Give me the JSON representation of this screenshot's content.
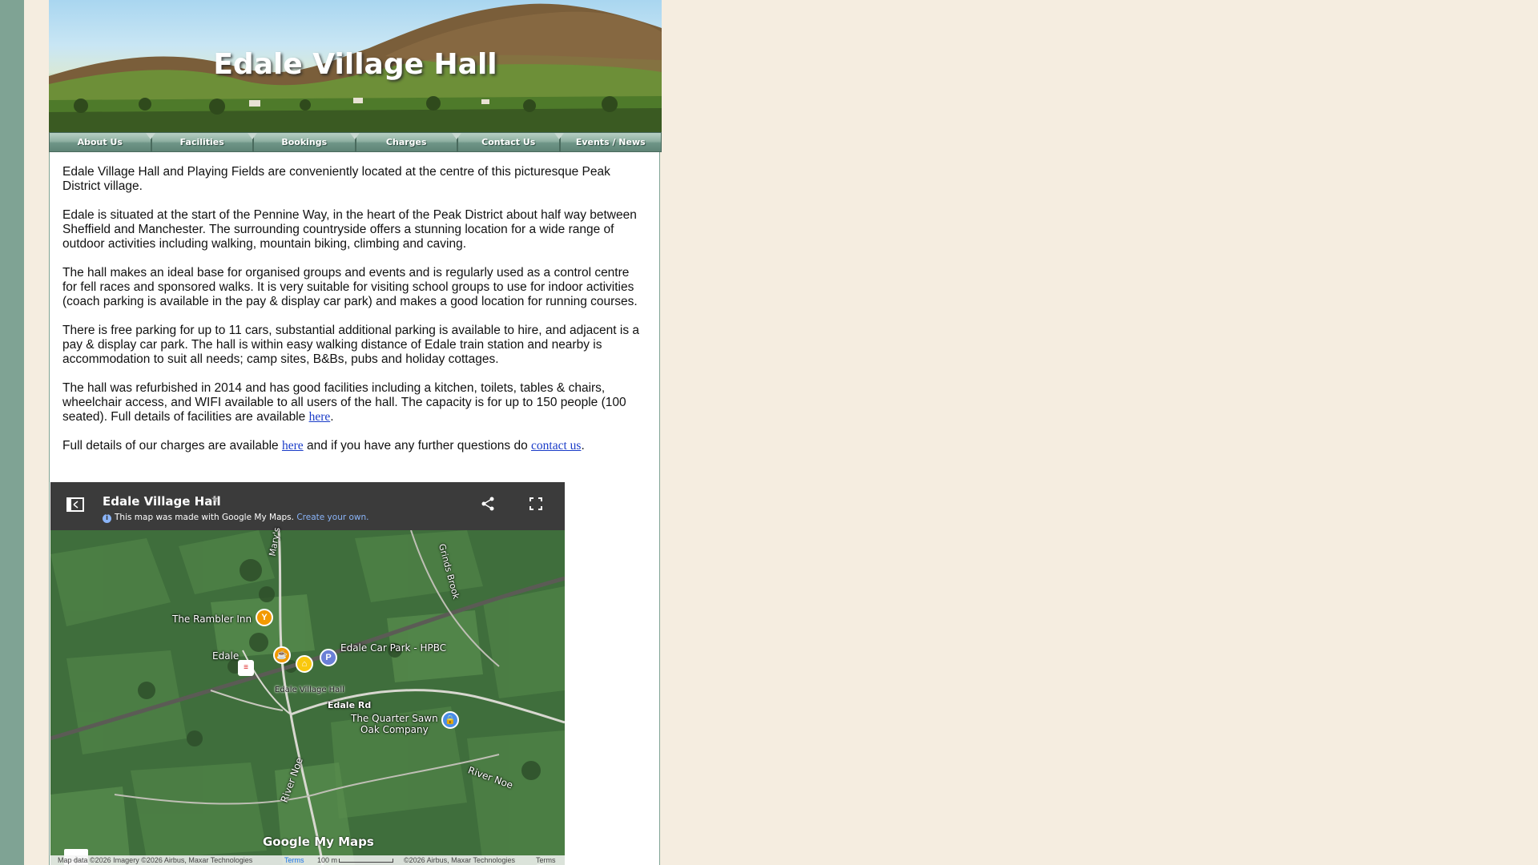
{
  "site": {
    "title": "Edale Village Hall"
  },
  "nav": {
    "items": [
      "About Us",
      "Facilities",
      "Bookings",
      "Charges",
      "Contact Us",
      "Events / News"
    ]
  },
  "content": {
    "p1": "Edale Village Hall and Playing Fields are conveniently located at the centre of this picturesque Peak District village.",
    "p2": "Edale is situated at the start of the Pennine Way, in the heart of the Peak District about half way between Sheffield and Manchester. The surrounding countryside offers a stunning location for a wide range of outdoor activities including walking, mountain biking, climbing and caving.",
    "p3": "The hall makes an ideal base for organised groups and events and is regularly used as a control centre for fell races and sponsored walks. It is very suitable for visiting school groups to use for indoor activities (coach parking is available in the pay & display car park) and makes a good location for running courses.",
    "p4": "There is free parking for up to 11 cars, substantial additional parking is available to hire, and adjacent is a pay & display car park. The hall is within easy walking distance of Edale train station and nearby is accommodation to suit all needs; camp sites, B&Bs, pubs and holiday cottages.",
    "p5_text": "The hall was refurbished in 2014 and has good facilities including a kitchen, toilets, tables & chairs, wheelchair access, and WIFI available to all users of the hall. The capacity is for up to 150 people (100 seated). Full details of facilities are available ",
    "p5_link": "here",
    "p5_end": ".",
    "p6_text": "Full details of our charges are available ",
    "p6_link1": "here",
    "p6_mid": " and if you have any further questions do ",
    "p6_link2": "contact us",
    "p6_end": "."
  },
  "map": {
    "title": "Edale Village Hall",
    "subtitle": "This map was made with Google My Maps.",
    "create_link": "Create your own.",
    "labels": {
      "rambler": "The Rambler Inn",
      "edale": "Edale",
      "car_park": "Edale Car Park - HPBC",
      "village_hall": "Edale Village Hall",
      "edale_rd": "Edale Rd",
      "quarter_sawn": "The Quarter Sawn\nOak Company",
      "river_noe_1": "River Noe",
      "river_noe_2": "River Noe",
      "grinds_brook": "Grinds Brook",
      "marys": "Mary's"
    },
    "zoom_in": "+",
    "zoom_out": "−",
    "google_logo": "Google My Maps",
    "attribution": {
      "left": "Map data ©2026 Imagery ©2026 Airbus, Maxar Technologies",
      "terms1": "Terms",
      "scale": "100 m",
      "right": "©2026 Airbus, Maxar Technologies",
      "terms2": "Terms"
    },
    "colors": {
      "header": "#3b3b3b",
      "pin_orange": "#f29900",
      "pin_yellow": "#f9c80e",
      "pin_blue": "#4a8ee8",
      "pin_parking": "#6b7fd7"
    }
  },
  "colors": {
    "background": "#f5ede0",
    "stripe": "#7fa394",
    "link": "#1a3cc8"
  }
}
